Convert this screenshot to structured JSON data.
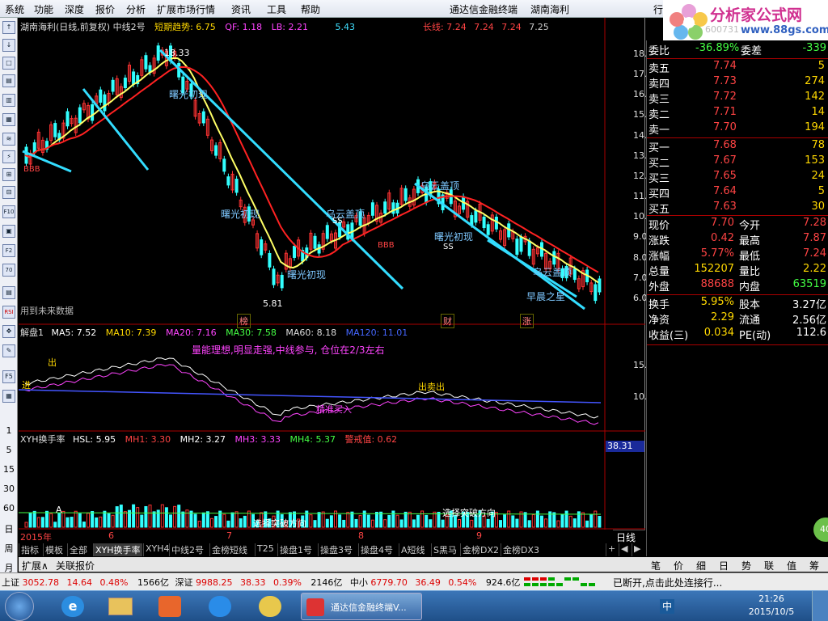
{
  "menu": {
    "items": [
      "系统",
      "功能",
      "深度",
      "报价",
      "分析",
      "扩展市场行情",
      "资讯",
      "工具",
      "帮助"
    ],
    "app_title": "通达信金融终端",
    "stock_title": "湖南海利",
    "right_partial": "行"
  },
  "logo": {
    "text": "分析家公式网",
    "url": "www.88gs.com",
    "faded": "600731"
  },
  "left_toolbar": {
    "buttons": [
      "↑",
      "↓",
      "□",
      "▤",
      "▥",
      "▦",
      "≋",
      "⚡",
      "⊞",
      "⊟",
      "F10",
      "▣",
      "F2",
      "70",
      "▤",
      "RSI",
      "✥",
      "✎",
      "F5",
      "▦"
    ],
    "numbers": [
      "1",
      "5",
      "15",
      "30",
      "60",
      "日",
      "周",
      "月"
    ]
  },
  "chart": {
    "header": {
      "title": "湖南海利(日线,前复权) 中线2号",
      "short_trend_label": "短期趋势: 6.75",
      "qf": "QF: 1.18",
      "lb": "LB: 2.21",
      "val": "5.43",
      "long_line": "长线: 7.24",
      "v2": "7.24",
      "v3": "7.24",
      "v4": "7.25"
    },
    "price_axis": [
      "18.00",
      "17.00",
      "16.00",
      "15.00",
      "14.00",
      "13.00",
      "12.00",
      "11.00",
      "10.00",
      "9.00",
      "8.00",
      "7.00",
      "6.00"
    ],
    "annotations": {
      "high": "18.33",
      "low": "5.81",
      "dawn1": "曙光初现",
      "dawn2": "曙光初现",
      "dawn3": "曙光初现",
      "dawn4": "曙光初现",
      "cloud1": "乌云盖顶",
      "cloud2": "乌云盖顶",
      "cloud3": "乌云盖顶",
      "morning": "早晨之星",
      "bbb1": "BBB",
      "bbb2": "BBB",
      "ss1": "SS",
      "ss2": "SS",
      "future": "用到未来数据",
      "bang": "榜",
      "cai": "财",
      "zhang": "涨"
    },
    "sub1": {
      "title": "解盘1",
      "ma5": "MA5: 7.52",
      "ma10": "MA10: 7.39",
      "ma20": "MA20: 7.16",
      "ma30": "MA30: 7.58",
      "ma60": "MA60: 8.18",
      "ma120": "MA120: 11.01",
      "axis": [
        "15.00",
        "10.00"
      ],
      "note": "量能理想,明显走强,中线参与, 仓位在2/3左右",
      "buy": "进",
      "sell": "出",
      "sellout": "出卖出",
      "jingbuy": "精准买入"
    },
    "sub2": {
      "title": "XYH换手率",
      "hsl": "HSL: 5.95",
      "mh1": "MH1: 3.30",
      "mh2": "MH2: 3.27",
      "mh3": "MH3: 3.33",
      "mh4": "MH4: 5.37",
      "warn": "警戒值: 0.62",
      "axis_value": "38.31",
      "direction1": "选择突破方向",
      "direction2": "选择突破方向",
      "a": "A"
    },
    "time_axis": [
      "2015年",
      "6",
      "7",
      "8",
      "9"
    ],
    "period": "日线"
  },
  "quote": {
    "wei_label": "委比",
    "wei_value": "-36.89%",
    "wei_diff_label": "委差",
    "wei_diff": "-339",
    "asks": [
      {
        "label": "卖五",
        "price": "7.74",
        "vol": "5"
      },
      {
        "label": "卖四",
        "price": "7.73",
        "vol": "274"
      },
      {
        "label": "卖三",
        "price": "7.72",
        "vol": "142"
      },
      {
        "label": "卖二",
        "price": "7.71",
        "vol": "14"
      },
      {
        "label": "卖一",
        "price": "7.70",
        "vol": "194"
      }
    ],
    "bids": [
      {
        "label": "买一",
        "price": "7.68",
        "vol": "78"
      },
      {
        "label": "买二",
        "price": "7.67",
        "vol": "153"
      },
      {
        "label": "买三",
        "price": "7.65",
        "vol": "24"
      },
      {
        "label": "买四",
        "price": "7.64",
        "vol": "5"
      },
      {
        "label": "买五",
        "price": "7.63",
        "vol": "30"
      }
    ],
    "stats": [
      {
        "l1": "现价",
        "v1": "7.70",
        "l2": "今开",
        "v2": "7.28"
      },
      {
        "l1": "涨跌",
        "v1": "0.42",
        "l2": "最高",
        "v2": "7.87"
      },
      {
        "l1": "涨幅",
        "v1": "5.77%",
        "l2": "最低",
        "v2": "7.24"
      },
      {
        "l1": "总量",
        "v1": "152207",
        "l2": "量比",
        "v2": "2.22"
      },
      {
        "l1": "外盘",
        "v1": "88688",
        "l2": "内盘",
        "v2": "63519"
      }
    ],
    "stats2": [
      {
        "l1": "换手",
        "v1": "5.95%",
        "l2": "股本",
        "v2": "3.27亿"
      },
      {
        "l1": "净资",
        "v1": "2.29",
        "l2": "流通",
        "v2": "2.56亿"
      },
      {
        "l1": "收益(三)",
        "v1": "0.034",
        "l2": "PE(动)",
        "v2": "112.6"
      }
    ],
    "bubble": "40"
  },
  "tabs": [
    "指标",
    "模板",
    "全部",
    "XYH换手率",
    "XYH4",
    "中线2号",
    "金榜短线",
    "T25",
    "操盘1号",
    "操盘3号",
    "操盘4号",
    "A短线",
    "S黑马",
    "金榜DX2",
    "金榜DX3"
  ],
  "tab_controls": [
    "+",
    "◀",
    "▶"
  ],
  "subtabs": [
    "扩展∧",
    "关联报价"
  ],
  "rp_tabs": [
    "笔",
    "价",
    "细",
    "日",
    "势",
    "联",
    "值",
    "筹"
  ],
  "status": {
    "sh_label": "上证",
    "sh_val": "3052.78",
    "sh_chg": "14.64",
    "sh_pct": "0.48%",
    "sh_amt": "1566亿",
    "sz_label": "深证",
    "sz_val": "9988.25",
    "sz_chg": "38.33",
    "sz_pct": "0.39%",
    "sz_amt": "2146亿",
    "zx_label": "中小",
    "zx_val": "6779.70",
    "zx_chg": "36.49",
    "zx_pct": "0.54%",
    "zx_amt": "924.6亿",
    "msg": "已断开,点击此处连接行..."
  },
  "taskbar": {
    "app_label": "通达信金融终端V...",
    "time": "21:26",
    "date": "2015/10/5",
    "ime": "中"
  }
}
